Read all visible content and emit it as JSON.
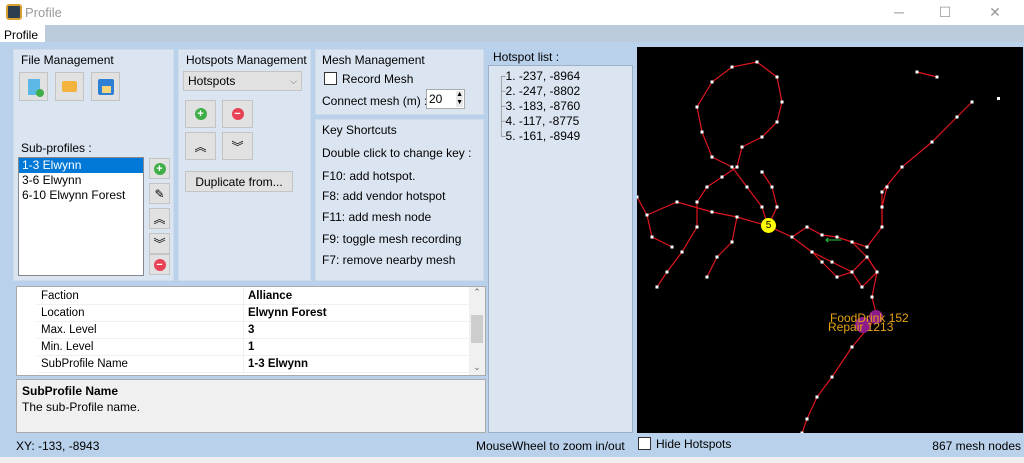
{
  "window": {
    "title": "Profile",
    "minimize": "─",
    "maximize": "☐",
    "close": "✕"
  },
  "tabs": [
    {
      "label": "Profile"
    }
  ],
  "file_management": {
    "title": "File Management",
    "sub_profiles_label": "Sub-profiles :",
    "sub_profiles": [
      "1-3 Elwynn",
      "3-6 Elwynn",
      "6-10 Elwynn Forest"
    ],
    "selected_index": 0
  },
  "hotspots_management": {
    "title": "Hotspots Management",
    "dropdown_value": "Hotspots",
    "duplicate_label": "Duplicate from..."
  },
  "mesh_management": {
    "title": "Mesh Management",
    "record_label": "Record Mesh",
    "record_checked": false,
    "connect_label": "Connect mesh (m) :",
    "connect_value": "20"
  },
  "key_shortcuts": {
    "title": "Key Shortcuts",
    "hint": "Double click to change key :",
    "items": [
      "F10: add hotspot.",
      "F8: add vendor hotspot",
      "F11: add mesh node",
      "F9: toggle mesh recording",
      "F7: remove nearby mesh"
    ]
  },
  "hotspot_list": {
    "title": "Hotspot list :",
    "items": [
      "1. -237, -8964",
      "2. -247, -8802",
      "3. -183, -8760",
      "4. -117, -8775",
      "5. -161, -8949"
    ]
  },
  "properties": [
    {
      "key": "Faction",
      "value": "Alliance"
    },
    {
      "key": "Location",
      "value": "Elwynn Forest"
    },
    {
      "key": "Max. Level",
      "value": "3"
    },
    {
      "key": "Min. Level",
      "value": "1"
    },
    {
      "key": "SubProfile Name",
      "value": "1-3 Elwynn"
    }
  ],
  "description": {
    "title": "SubProfile Name",
    "text": "The sub-Profile name."
  },
  "map": {
    "hotspot_marker": "5",
    "labels": [
      "FoodDrink 152",
      "Repair 1213"
    ],
    "hide_hotspots_label": "Hide Hotspots",
    "hide_hotspots_checked": false,
    "mesh_color": "#e0161f",
    "label_color": "#e6a317",
    "vendor_color": "#8b1a8b"
  },
  "status": {
    "xy": "XY: -133, -8943",
    "zoom_hint": "MouseWheel to zoom in/out",
    "mesh_nodes": "867 mesh nodes"
  }
}
